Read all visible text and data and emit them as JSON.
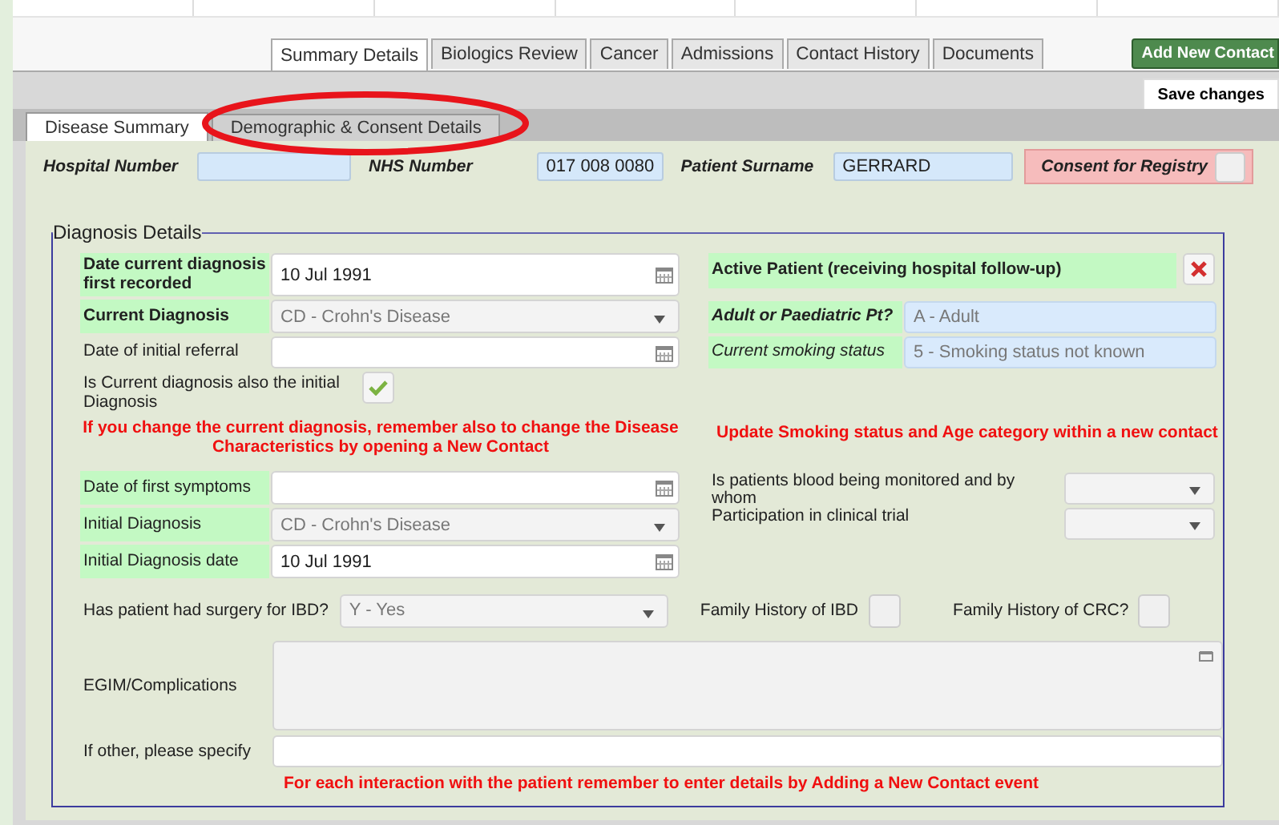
{
  "top_tabs": [
    {
      "label": "Summary Details",
      "selected": true
    },
    {
      "label": "Biologics Review",
      "selected": false
    },
    {
      "label": "Cancer",
      "selected": false
    },
    {
      "label": "Admissions",
      "selected": false
    },
    {
      "label": "Contact History",
      "selected": false
    },
    {
      "label": "Documents",
      "selected": false
    }
  ],
  "add_contact_button": "Add New Contact",
  "save_button": "Save changes",
  "sub_tabs": [
    {
      "label": "Disease Summary",
      "selected": true
    },
    {
      "label": "Demographic & Consent Details",
      "selected": false
    }
  ],
  "header_fields": [
    {
      "label": "Hospital Number"
    },
    {
      "label": "NHS Number",
      "value": "017 008 0080"
    },
    {
      "label": "Patient Surname",
      "value": "GERRARD"
    }
  ],
  "consent": {
    "label": "Consent for Registry",
    "checked": false
  },
  "diagnosis": {
    "legend": "Diagnosis Details",
    "left_top": [
      {
        "kind": "date",
        "label": "Date current diagnosis first recorded",
        "value": "10 Jul 1991",
        "highlighted": true
      },
      {
        "kind": "select",
        "label": "Current Diagnosis",
        "value": "CD - Crohn's Disease",
        "highlighted": true
      },
      {
        "kind": "date",
        "label": "Date of initial referral",
        "highlighted": false
      },
      {
        "kind": "toggle",
        "label": "Is Current diagnosis also the initial Diagnosis",
        "checked": true,
        "highlighted": false
      }
    ],
    "left_warning": "If you change the current diagnosis, remember also to change the Disease Characteristics by opening a New Contact",
    "left_bottom": [
      {
        "kind": "date",
        "label": "Date of first symptoms",
        "highlighted": true
      },
      {
        "kind": "select",
        "label": "Initial Diagnosis",
        "value": "CD - Crohn's Disease",
        "highlighted": true
      },
      {
        "kind": "date",
        "label": "Initial Diagnosis date",
        "value": "10 Jul 1991",
        "highlighted": true
      }
    ],
    "right_top": [
      {
        "kind": "toggle",
        "label": "Active Patient (receiving hospital follow-up)",
        "crossed": true,
        "highlighted": true
      },
      {
        "kind": "readonly",
        "label": "Adult or Paediatric Pt?",
        "value": "A - Adult",
        "highlighted": true
      },
      {
        "kind": "readonly",
        "label": "Current smoking status",
        "value": "5 - Smoking status not known",
        "highlighted": true
      }
    ],
    "right_warning": "Update Smoking status and Age category within a new contact",
    "right_bottom": [
      {
        "kind": "select",
        "label": "Is patients blood being monitored and by whom",
        "highlighted": false
      },
      {
        "kind": "select",
        "label": "Participation in clinical trial",
        "highlighted": false
      }
    ],
    "surgery": {
      "label": "Has patient had surgery for IBD?",
      "value": "Y - Yes"
    },
    "family_history": [
      {
        "label": "Family History of IBD",
        "checked": false
      },
      {
        "label": "Family History of CRC?",
        "checked": false
      }
    ],
    "complications": {
      "label": "EGIM/Complications"
    },
    "other": {
      "label": "If other, please specify"
    },
    "footer_warning": "For each interaction with the patient remember to enter details by Adding a New Contact event"
  }
}
